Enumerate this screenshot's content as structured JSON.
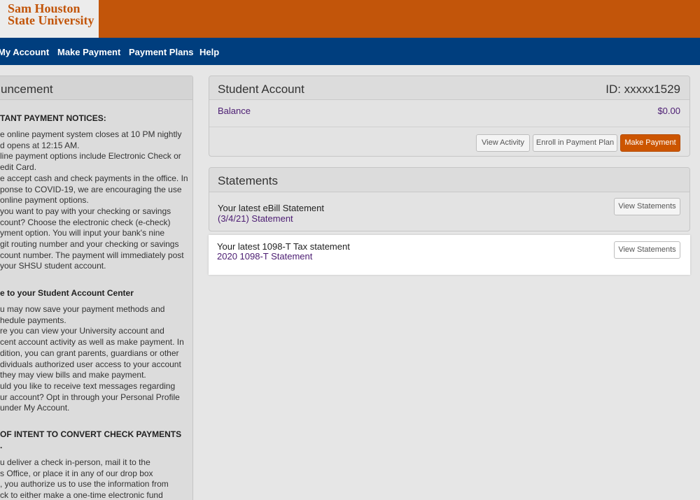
{
  "header": {
    "logo_line1": "Sam Houston",
    "logo_line2": "State University"
  },
  "nav": {
    "items": [
      "My Account",
      "Make Payment",
      "Payment Plans",
      "Help"
    ]
  },
  "announcement": {
    "title": "uncement",
    "notices_heading": "TANT PAYMENT NOTICES:",
    "notices_lines": [
      "e online payment system closes at 10 PM nightly",
      "d opens at 12:15 AM.",
      "line payment options include Electronic Check or",
      "edit Card.",
      "e accept cash and check payments in the office. In",
      "ponse to COVID-19, we are encouraging the use",
      "online payment options.",
      "you want to pay with your checking or savings",
      "count? Choose the electronic check (e-check)",
      "yment option.  You will input your bank's nine",
      "git routing number and your checking or savings",
      "count number.  The payment will immediately post",
      "your SHSU student account."
    ],
    "welcome_heading": "e to your Student Account Center",
    "welcome_lines": [
      "u may now save your payment methods and",
      "hedule payments.",
      "re you can view your University account and",
      "cent account activity as well as make payment. In",
      "dition, you can grant parents, guardians or other",
      "dividuals authorized user access to your account",
      "they may view bills and make payment.",
      "uld you like to receive text messages regarding",
      "ur account? Opt in through your Personal Profile",
      "under My Account."
    ],
    "intent_heading_1": "OF INTENT TO CONVERT CHECK PAYMENTS",
    "intent_heading_2": ".",
    "intent_lines": [
      "u deliver a check in-person, mail it to the",
      "s Office, or place it in any of our drop box",
      ", you authorize us to use the information from",
      "ck to either make a one-time electronic fund"
    ]
  },
  "student_account": {
    "title": "Student Account",
    "id_text": "ID: xxxxx1529",
    "balance_label": "Balance",
    "balance_value": "$0.00",
    "buttons": {
      "view_activity": "View Activity",
      "enroll": "Enroll in Payment Plan",
      "make_payment": "Make Payment"
    }
  },
  "statements": {
    "title": "Statements",
    "rows": [
      {
        "title": "Your latest eBill Statement",
        "link": "(3/4/21) Statement",
        "button": "View Statements"
      },
      {
        "title": "Your latest 1098-T Tax statement",
        "link": "2020 1098-T Statement",
        "button": "View Statements"
      }
    ]
  },
  "colors": {
    "brand_orange": "#c2550a",
    "nav_blue": "#003e7e",
    "link_purple": "#4b1c72",
    "primary_button": "#cc5500"
  }
}
